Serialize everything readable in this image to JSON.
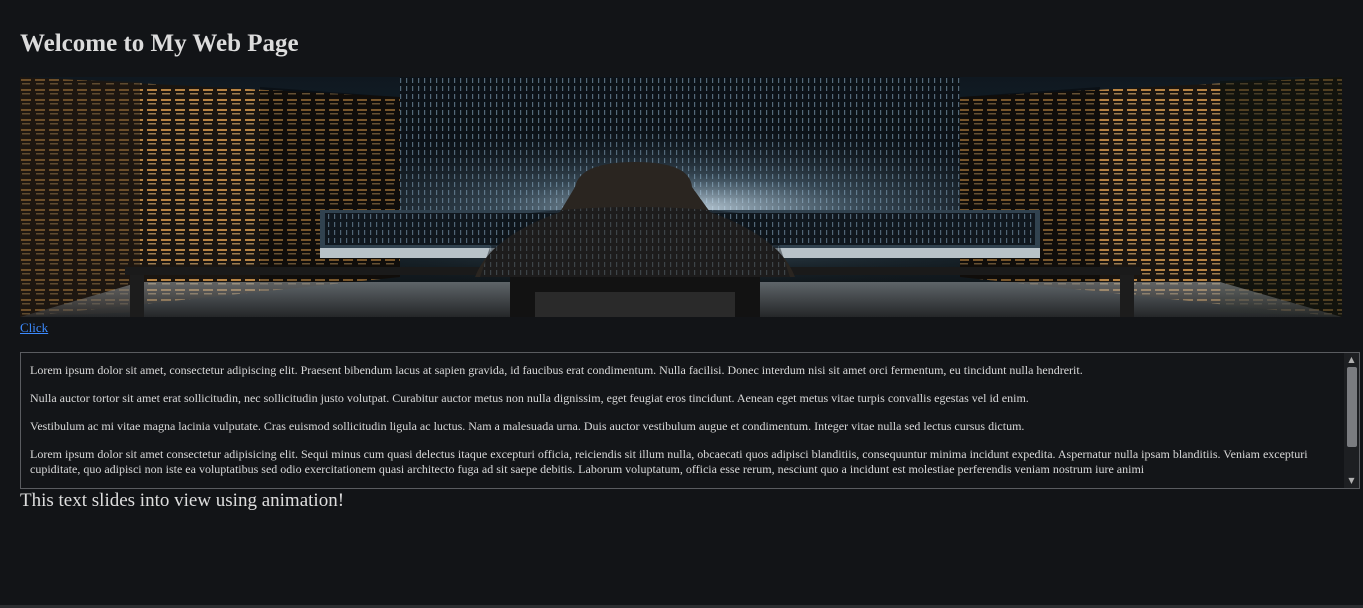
{
  "header": {
    "title": "Welcome to My Web Page"
  },
  "banner": {
    "icon": "hacker-server-room-image"
  },
  "link": {
    "label": "Click"
  },
  "scroll_box": {
    "paragraphs": [
      "Lorem ipsum dolor sit amet, consectetur adipiscing elit. Praesent bibendum lacus at sapien gravida, id faucibus erat condimentum. Nulla facilisi. Donec interdum nisi sit amet orci fermentum, eu tincidunt nulla hendrerit.",
      "Nulla auctor tortor sit amet erat sollicitudin, nec sollicitudin justo volutpat. Curabitur auctor metus non nulla dignissim, eget feugiat eros tincidunt. Aenean eget metus vitae turpis convallis egestas vel id enim.",
      "Vestibulum ac mi vitae magna lacinia vulputate. Cras euismod sollicitudin ligula ac luctus. Nam a malesuada urna. Duis auctor vestibulum augue et condimentum. Integer vitae nulla sed lectus cursus dictum.",
      "Lorem ipsum dolor sit amet consectetur adipisicing elit. Sequi minus cum quasi delectus itaque excepturi officia, reiciendis sit illum nulla, obcaecati quos adipisci blanditiis, consequuntur minima incidunt expedita. Aspernatur nulla ipsam blanditiis. Veniam excepturi cupiditate, quo adipisci non iste ea voluptatibus sed odio exercitationem quasi architecto fuga ad sit saepe debitis. Laborum voluptatum, officia esse rerum, nesciunt quo a incidunt est molestiae perferendis veniam nostrum iure animi"
    ]
  },
  "animated_text": "This text slides into view using animation!"
}
